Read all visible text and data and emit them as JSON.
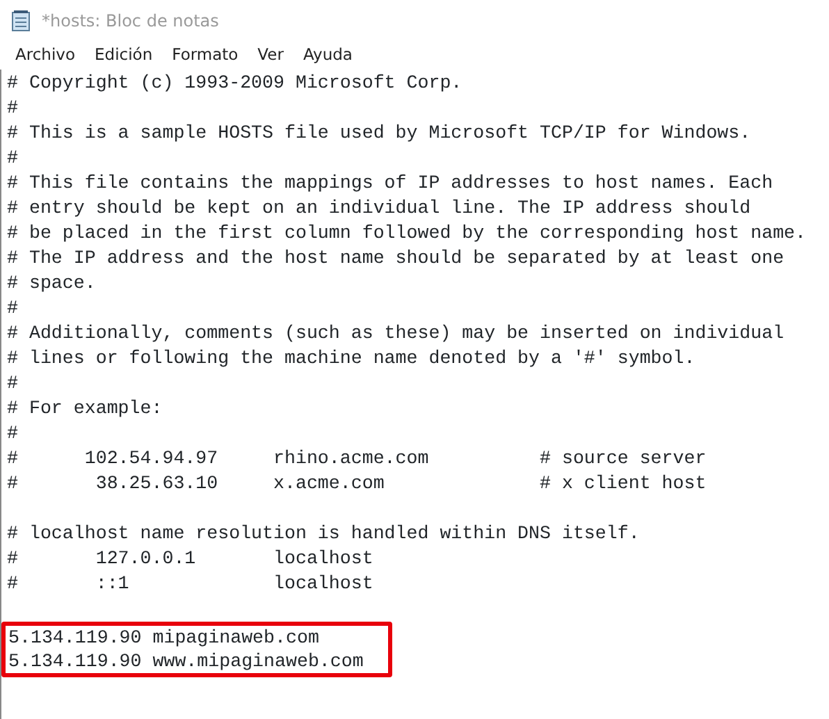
{
  "window": {
    "title": "*hosts: Bloc de notas"
  },
  "menu": [
    "Archivo",
    "Edición",
    "Formato",
    "Ver",
    "Ayuda"
  ],
  "editor": {
    "blocks": [
      {
        "highlighted": false,
        "lines": [
          "# Copyright (c) 1993-2009 Microsoft Corp.",
          "#",
          "# This is a sample HOSTS file used by Microsoft TCP/IP for Windows.",
          "#",
          "# This file contains the mappings of IP addresses to host names. Each",
          "# entry should be kept on an individual line. The IP address should",
          "# be placed in the first column followed by the corresponding host name.",
          "# The IP address and the host name should be separated by at least one",
          "# space.",
          "#",
          "# Additionally, comments (such as these) may be inserted on individual",
          "# lines or following the machine name denoted by a '#' symbol.",
          "#",
          "# For example:",
          "#",
          "#      102.54.94.97     rhino.acme.com          # source server",
          "#       38.25.63.10     x.acme.com              # x client host"
        ]
      },
      {
        "highlighted": false,
        "lines": [
          "# localhost name resolution is handled within DNS itself.",
          "#       127.0.0.1       localhost",
          "#       ::1             localhost"
        ]
      },
      {
        "highlighted": true,
        "lines": [
          "5.134.119.90 mipaginaweb.com",
          "5.134.119.90 www.mipaginaweb.com"
        ]
      }
    ]
  }
}
